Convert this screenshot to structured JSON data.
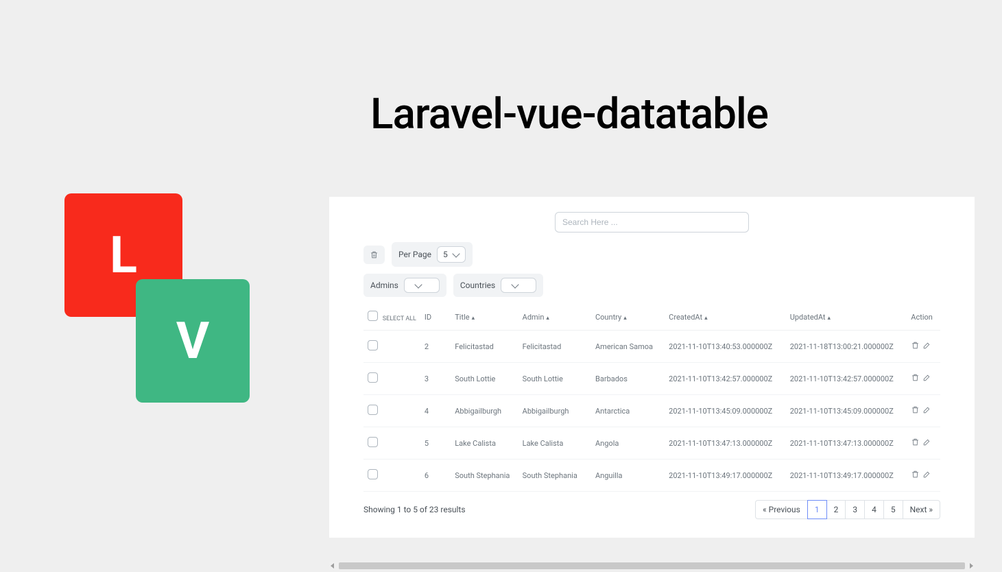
{
  "title": "Laravel-vue-datatable",
  "logo": {
    "l": "L",
    "v": "V"
  },
  "search": {
    "placeholder": "Search Here ..."
  },
  "perPage": {
    "label": "Per Page",
    "value": "5"
  },
  "filters": {
    "admins": "Admins",
    "countries": "Countries"
  },
  "columns": {
    "select_all": "SELECT ALL",
    "id": "ID",
    "title": "Title",
    "admin": "Admin",
    "country": "Country",
    "created": "CreatedAt",
    "updated": "UpdatedAt",
    "action": "Action"
  },
  "rows": [
    {
      "id": "2",
      "title": "Felicitastad",
      "admin": "Felicitastad",
      "country": "American Samoa",
      "created": "2021-11-10T13:40:53.000000Z",
      "updated": "2021-11-18T13:00:21.000000Z"
    },
    {
      "id": "3",
      "title": "South Lottie",
      "admin": "South Lottie",
      "country": "Barbados",
      "created": "2021-11-10T13:42:57.000000Z",
      "updated": "2021-11-10T13:42:57.000000Z"
    },
    {
      "id": "4",
      "title": "Abbigailburgh",
      "admin": "Abbigailburgh",
      "country": "Antarctica",
      "created": "2021-11-10T13:45:09.000000Z",
      "updated": "2021-11-10T13:45:09.000000Z"
    },
    {
      "id": "5",
      "title": "Lake Calista",
      "admin": "Lake Calista",
      "country": "Angola",
      "created": "2021-11-10T13:47:13.000000Z",
      "updated": "2021-11-10T13:47:13.000000Z"
    },
    {
      "id": "6",
      "title": "South Stephania",
      "admin": "South Stephania",
      "country": "Anguilla",
      "created": "2021-11-10T13:49:17.000000Z",
      "updated": "2021-11-10T13:49:17.000000Z"
    }
  ],
  "footer": {
    "summary": "Showing 1 to 5 of 23 results",
    "prev": "« Previous",
    "next": "Next »",
    "pages": [
      "1",
      "2",
      "3",
      "4",
      "5"
    ],
    "active": "1"
  }
}
